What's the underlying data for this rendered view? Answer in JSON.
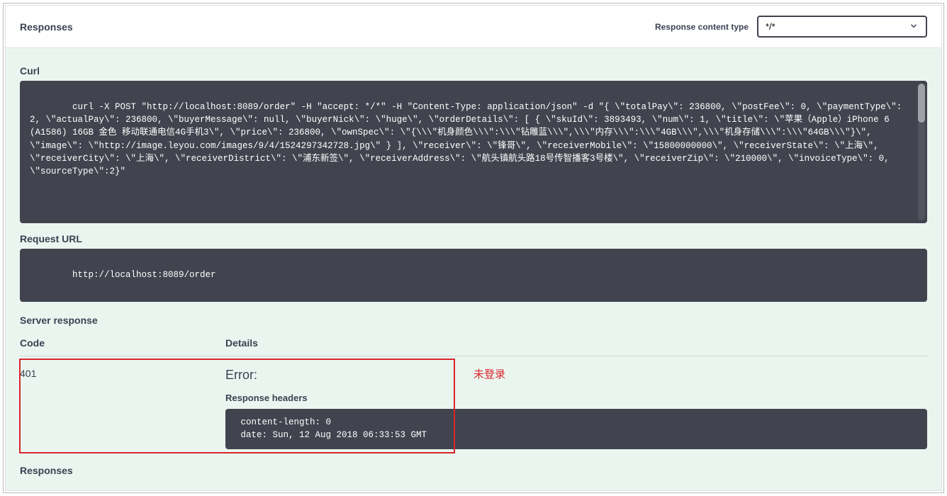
{
  "header": {
    "title": "Responses",
    "content_type_label": "Response content type",
    "content_type_value": "*/*"
  },
  "curl": {
    "label": "Curl",
    "command": "curl -X POST \"http://localhost:8089/order\" -H \"accept: */*\" -H \"Content-Type: application/json\" -d \"{ \\\"totalPay\\\": 236800, \\\"postFee\\\": 0, \\\"paymentType\\\": 2, \\\"actualPay\\\": 236800, \\\"buyerMessage\\\": null, \\\"buyerNick\\\": \\\"huge\\\", \\\"orderDetails\\\": [ { \\\"skuId\\\": 3893493, \\\"num\\\": 1, \\\"title\\\": \\\"苹果（Apple）iPhone 6 (A1586) 16GB 金色 移动联通电信4G手机3\\\", \\\"price\\\": 236800, \\\"ownSpec\\\": \\\"{\\\\\\\"机身颜色\\\\\\\":\\\\\\\"钻雕蓝\\\\\\\",\\\\\\\"内存\\\\\\\":\\\\\\\"4GB\\\\\\\",\\\\\\\"机身存储\\\\\\\":\\\\\\\"64GB\\\\\\\"}\\\", \\\"image\\\": \\\"http://image.leyou.com/images/9/4/1524297342728.jpg\\\" } ], \\\"receiver\\\": \\\"锋哥\\\", \\\"receiverMobile\\\": \\\"15800000000\\\", \\\"receiverState\\\": \\\"上海\\\", \\\"receiverCity\\\": \\\"上海\\\", \\\"receiverDistrict\\\": \\\"浦东新签\\\", \\\"receiverAddress\\\": \\\"航头镇航头路18号传智播客3号楼\\\", \\\"receiverZip\\\": \\\"210000\\\", \\\"invoiceType\\\": 0, \\\"sourceType\\\":2}\""
  },
  "request_url": {
    "label": "Request URL",
    "value": "http://localhost:8089/order"
  },
  "server_response": {
    "label": "Server response",
    "columns": {
      "code": "Code",
      "details": "Details"
    },
    "code": "401",
    "error_label": "Error:",
    "headers_label": "Response headers",
    "headers": " content-length: 0 \n date: Sun, 12 Aug 2018 06:33:53 GMT "
  },
  "annotation": "未登录",
  "footer": "Responses"
}
